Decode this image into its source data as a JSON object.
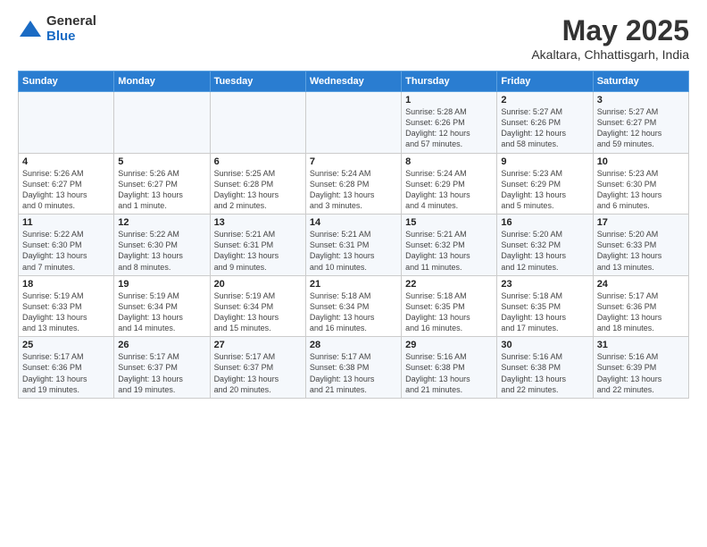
{
  "header": {
    "logo_general": "General",
    "logo_blue": "Blue",
    "month": "May 2025",
    "location": "Akaltara, Chhattisgarh, India"
  },
  "weekdays": [
    "Sunday",
    "Monday",
    "Tuesday",
    "Wednesday",
    "Thursday",
    "Friday",
    "Saturday"
  ],
  "weeks": [
    [
      {
        "day": "",
        "info": ""
      },
      {
        "day": "",
        "info": ""
      },
      {
        "day": "",
        "info": ""
      },
      {
        "day": "",
        "info": ""
      },
      {
        "day": "1",
        "info": "Sunrise: 5:28 AM\nSunset: 6:26 PM\nDaylight: 12 hours\nand 57 minutes."
      },
      {
        "day": "2",
        "info": "Sunrise: 5:27 AM\nSunset: 6:26 PM\nDaylight: 12 hours\nand 58 minutes."
      },
      {
        "day": "3",
        "info": "Sunrise: 5:27 AM\nSunset: 6:27 PM\nDaylight: 12 hours\nand 59 minutes."
      }
    ],
    [
      {
        "day": "4",
        "info": "Sunrise: 5:26 AM\nSunset: 6:27 PM\nDaylight: 13 hours\nand 0 minutes."
      },
      {
        "day": "5",
        "info": "Sunrise: 5:26 AM\nSunset: 6:27 PM\nDaylight: 13 hours\nand 1 minute."
      },
      {
        "day": "6",
        "info": "Sunrise: 5:25 AM\nSunset: 6:28 PM\nDaylight: 13 hours\nand 2 minutes."
      },
      {
        "day": "7",
        "info": "Sunrise: 5:24 AM\nSunset: 6:28 PM\nDaylight: 13 hours\nand 3 minutes."
      },
      {
        "day": "8",
        "info": "Sunrise: 5:24 AM\nSunset: 6:29 PM\nDaylight: 13 hours\nand 4 minutes."
      },
      {
        "day": "9",
        "info": "Sunrise: 5:23 AM\nSunset: 6:29 PM\nDaylight: 13 hours\nand 5 minutes."
      },
      {
        "day": "10",
        "info": "Sunrise: 5:23 AM\nSunset: 6:30 PM\nDaylight: 13 hours\nand 6 minutes."
      }
    ],
    [
      {
        "day": "11",
        "info": "Sunrise: 5:22 AM\nSunset: 6:30 PM\nDaylight: 13 hours\nand 7 minutes."
      },
      {
        "day": "12",
        "info": "Sunrise: 5:22 AM\nSunset: 6:30 PM\nDaylight: 13 hours\nand 8 minutes."
      },
      {
        "day": "13",
        "info": "Sunrise: 5:21 AM\nSunset: 6:31 PM\nDaylight: 13 hours\nand 9 minutes."
      },
      {
        "day": "14",
        "info": "Sunrise: 5:21 AM\nSunset: 6:31 PM\nDaylight: 13 hours\nand 10 minutes."
      },
      {
        "day": "15",
        "info": "Sunrise: 5:21 AM\nSunset: 6:32 PM\nDaylight: 13 hours\nand 11 minutes."
      },
      {
        "day": "16",
        "info": "Sunrise: 5:20 AM\nSunset: 6:32 PM\nDaylight: 13 hours\nand 12 minutes."
      },
      {
        "day": "17",
        "info": "Sunrise: 5:20 AM\nSunset: 6:33 PM\nDaylight: 13 hours\nand 13 minutes."
      }
    ],
    [
      {
        "day": "18",
        "info": "Sunrise: 5:19 AM\nSunset: 6:33 PM\nDaylight: 13 hours\nand 13 minutes."
      },
      {
        "day": "19",
        "info": "Sunrise: 5:19 AM\nSunset: 6:34 PM\nDaylight: 13 hours\nand 14 minutes."
      },
      {
        "day": "20",
        "info": "Sunrise: 5:19 AM\nSunset: 6:34 PM\nDaylight: 13 hours\nand 15 minutes."
      },
      {
        "day": "21",
        "info": "Sunrise: 5:18 AM\nSunset: 6:34 PM\nDaylight: 13 hours\nand 16 minutes."
      },
      {
        "day": "22",
        "info": "Sunrise: 5:18 AM\nSunset: 6:35 PM\nDaylight: 13 hours\nand 16 minutes."
      },
      {
        "day": "23",
        "info": "Sunrise: 5:18 AM\nSunset: 6:35 PM\nDaylight: 13 hours\nand 17 minutes."
      },
      {
        "day": "24",
        "info": "Sunrise: 5:17 AM\nSunset: 6:36 PM\nDaylight: 13 hours\nand 18 minutes."
      }
    ],
    [
      {
        "day": "25",
        "info": "Sunrise: 5:17 AM\nSunset: 6:36 PM\nDaylight: 13 hours\nand 19 minutes."
      },
      {
        "day": "26",
        "info": "Sunrise: 5:17 AM\nSunset: 6:37 PM\nDaylight: 13 hours\nand 19 minutes."
      },
      {
        "day": "27",
        "info": "Sunrise: 5:17 AM\nSunset: 6:37 PM\nDaylight: 13 hours\nand 20 minutes."
      },
      {
        "day": "28",
        "info": "Sunrise: 5:17 AM\nSunset: 6:38 PM\nDaylight: 13 hours\nand 21 minutes."
      },
      {
        "day": "29",
        "info": "Sunrise: 5:16 AM\nSunset: 6:38 PM\nDaylight: 13 hours\nand 21 minutes."
      },
      {
        "day": "30",
        "info": "Sunrise: 5:16 AM\nSunset: 6:38 PM\nDaylight: 13 hours\nand 22 minutes."
      },
      {
        "day": "31",
        "info": "Sunrise: 5:16 AM\nSunset: 6:39 PM\nDaylight: 13 hours\nand 22 minutes."
      }
    ]
  ]
}
